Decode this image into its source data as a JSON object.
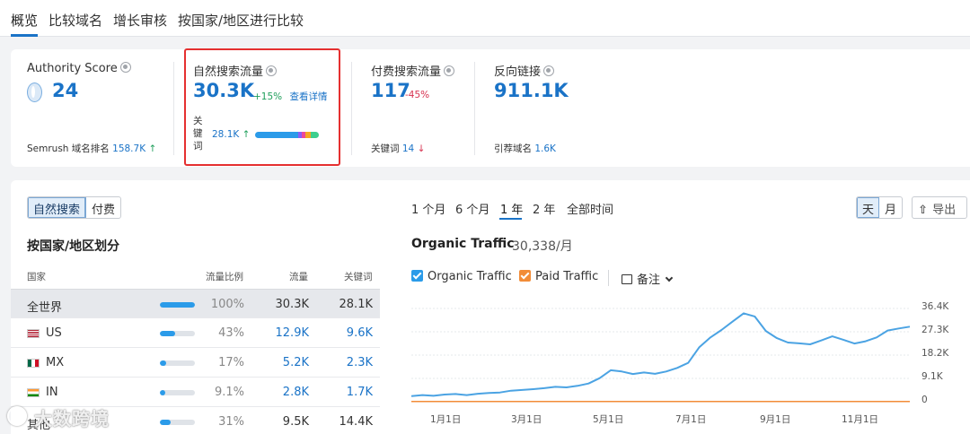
{
  "tabs": [
    "概览",
    "比较域名",
    "增长审核",
    "按国家/地区进行比较"
  ],
  "metrics": {
    "authority": {
      "title": "Authority Score",
      "value": "24",
      "foot_label": "Semrush 域名排名",
      "foot_value": "158.7K",
      "foot_arrow": "↑"
    },
    "organic": {
      "title": "自然搜索流量",
      "value": "30.3K",
      "change": "+15%",
      "link": "查看详情",
      "kw_label": "关键词",
      "kw_value": "28.1K",
      "kw_arrow": "↑"
    },
    "paid": {
      "title": "付费搜索流量",
      "value": "117",
      "change": "-45%",
      "foot_label": "关键词",
      "foot_value": "14",
      "foot_arrow": "↓"
    },
    "backlinks": {
      "title": "反向链接",
      "value": "911.1K",
      "foot_label": "引荐域名",
      "foot_value": "1.6K"
    }
  },
  "search_toggle": {
    "organic": "自然搜索",
    "paid": "付费"
  },
  "country_section": {
    "title": "按国家/地区划分",
    "headers": {
      "country": "国家",
      "share": "流量比例",
      "traffic": "流量",
      "keywords": "关键词"
    },
    "rows": [
      {
        "name": "全世界",
        "share_num": 100,
        "share": "100%",
        "traffic": "30.3K",
        "keywords": "28.1K"
      },
      {
        "name": "US",
        "share_num": 43,
        "share": "43%",
        "traffic": "12.9K",
        "keywords": "9.6K"
      },
      {
        "name": "MX",
        "share_num": 17,
        "share": "17%",
        "traffic": "5.2K",
        "keywords": "2.3K"
      },
      {
        "name": "IN",
        "share_num": 9.1,
        "share": "9.1%",
        "traffic": "2.8K",
        "keywords": "1.7K"
      },
      {
        "name": "其他",
        "share_num": 31,
        "share": "31%",
        "traffic": "9.5K",
        "keywords": "14.4K"
      }
    ]
  },
  "periods": [
    "1 个月",
    "6 个月",
    "1 年",
    "2 年",
    "全部时间"
  ],
  "granularity": {
    "day": "天",
    "month": "月"
  },
  "export_label": "导出",
  "chart_header": {
    "title": "Organic Traffic",
    "subtitle": "30,338/月"
  },
  "legend": {
    "organic": "Organic Traffic",
    "paid": "Paid Traffic",
    "notes": "备注"
  },
  "colors": {
    "accent": "#1a73c7",
    "organic": "#4ba3e3",
    "paid": "#f28c38",
    "highlight_box": "#e53030"
  },
  "watermark": "大数跨境",
  "chart_data": {
    "type": "line",
    "x_labels": [
      "1月1日",
      "3月1日",
      "5月1日",
      "7月1日",
      "9月1日",
      "11月1日"
    ],
    "y_ticks": [
      "36.4K",
      "27.3K",
      "18.2K",
      "9.1K",
      "0"
    ],
    "ylim": [
      0,
      36400
    ],
    "series": [
      {
        "name": "Organic Traffic",
        "values": [
          2200,
          2600,
          2300,
          2800,
          3000,
          2600,
          3100,
          3400,
          3600,
          4300,
          4600,
          4900,
          5300,
          5800,
          5600,
          6200,
          7100,
          9200,
          12300,
          11800,
          10800,
          11400,
          10900,
          11800,
          13200,
          15200,
          21300,
          25100,
          28000,
          31300,
          34500,
          33300,
          27600,
          24800,
          23100,
          22800,
          22400,
          23900,
          25500,
          24200,
          22700,
          23600,
          25100,
          27800,
          28600,
          29300
        ]
      },
      {
        "name": "Paid Traffic",
        "values": [
          100,
          100,
          100,
          100,
          100,
          100,
          100,
          100,
          100,
          100,
          100,
          100,
          100,
          100,
          100,
          100,
          100,
          100,
          100,
          100,
          100,
          100,
          100,
          100,
          100,
          100,
          100,
          100,
          100,
          100,
          100,
          100,
          100,
          100,
          100,
          100,
          100,
          100,
          100,
          100,
          100,
          100,
          100,
          100,
          100,
          100
        ]
      }
    ]
  }
}
